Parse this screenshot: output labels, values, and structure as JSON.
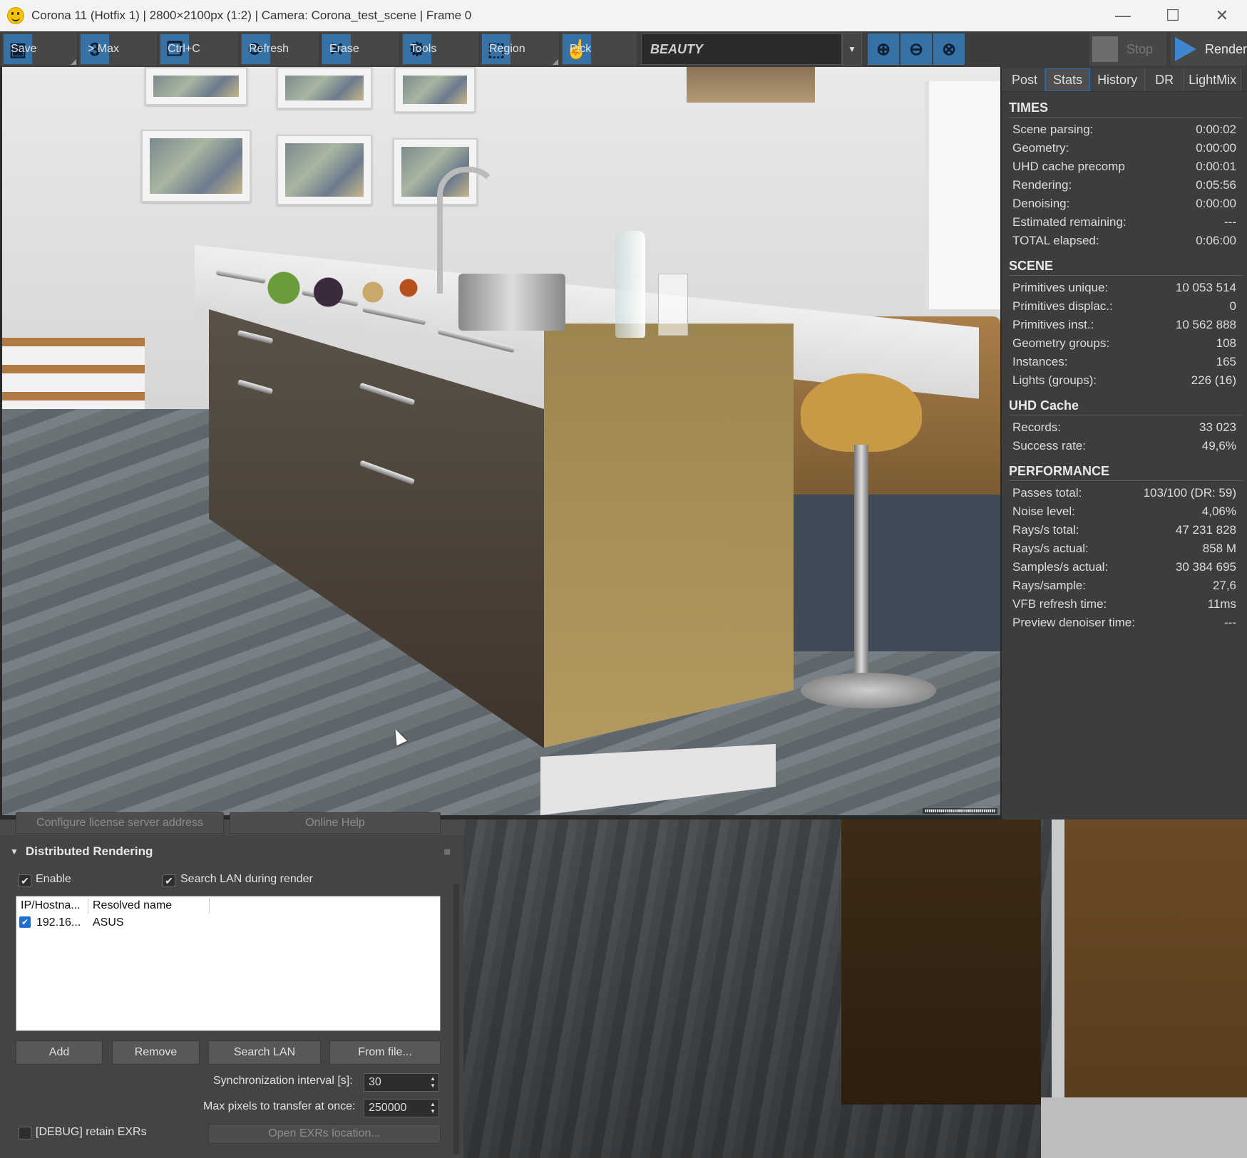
{
  "window": {
    "title": "Corona 11 (Hotfix 1) | 2800×2100px (1:2) | Camera: Corona_test_scene | Frame 0",
    "minimize": "—",
    "maximize": "☐",
    "close": "✕"
  },
  "toolbar": {
    "save": "Save",
    "max": "> Max",
    "copy": "Ctrl+C",
    "refresh": "Refresh",
    "erase": "Erase",
    "tools": "Tools",
    "region": "Region",
    "pick": "Pick",
    "channel": "BEAUTY",
    "stop": "Stop",
    "render": "Render"
  },
  "tabs": [
    "Post",
    "Stats",
    "History",
    "DR",
    "LightMix"
  ],
  "stats": {
    "times_title": "TIMES",
    "times": [
      {
        "label": "Scene parsing:",
        "value": "0:00:02"
      },
      {
        "label": "Geometry:",
        "value": "0:00:00"
      },
      {
        "label": "UHD cache precomp",
        "value": "0:00:01"
      },
      {
        "label": "Rendering:",
        "value": "0:05:56"
      },
      {
        "label": "Denoising:",
        "value": "0:00:00"
      },
      {
        "label": "Estimated remaining:",
        "value": "---"
      },
      {
        "label": "TOTAL elapsed:",
        "value": "0:06:00"
      }
    ],
    "scene_title": "SCENE",
    "scene": [
      {
        "label": "Primitives unique:",
        "value": "10 053 514"
      },
      {
        "label": "Primitives displac.:",
        "value": "0"
      },
      {
        "label": "Primitives inst.:",
        "value": "10 562 888"
      },
      {
        "label": "Geometry groups:",
        "value": "108"
      },
      {
        "label": "Instances:",
        "value": "165"
      },
      {
        "label": "Lights (groups):",
        "value": "226 (16)"
      }
    ],
    "uhd_title": "UHD Cache",
    "uhd": [
      {
        "label": "Records:",
        "value": "33 023"
      },
      {
        "label": "Success rate:",
        "value": "49,6%"
      }
    ],
    "perf_title": "PERFORMANCE",
    "perf": [
      {
        "label": "Passes total:",
        "value": "103/100 (DR: 59)"
      },
      {
        "label": "Noise level:",
        "value": "4,06%"
      },
      {
        "label": "Rays/s total:",
        "value": "47 231 828"
      },
      {
        "label": "Rays/s actual:",
        "value": "858 M"
      },
      {
        "label": "Samples/s actual:",
        "value": "30 384 695"
      },
      {
        "label": "Rays/sample:",
        "value": "27,6"
      },
      {
        "label": "VFB refresh time:",
        "value": "11ms"
      },
      {
        "label": "Preview denoiser time:",
        "value": "---"
      }
    ]
  },
  "dr": {
    "top_left_button": "Configure license server address",
    "top_right_button": "Online Help",
    "title": "Distributed Rendering",
    "enable_label": "Enable",
    "search_lan_label": "Search LAN during render",
    "col_ip": "IP/Hostna...",
    "col_name": "Resolved name",
    "row_ip": "192.16...",
    "row_name": "ASUS",
    "add": "Add",
    "remove": "Remove",
    "search_lan": "Search LAN",
    "from_file": "From file...",
    "sync_label": "Synchronization interval [s]:",
    "sync_value": "30",
    "maxpix_label": "Max pixels to transfer at once:",
    "maxpix_value": "250000",
    "debug_label": "[DEBUG] retain EXRs",
    "open_exr": "Open EXRs location..."
  }
}
